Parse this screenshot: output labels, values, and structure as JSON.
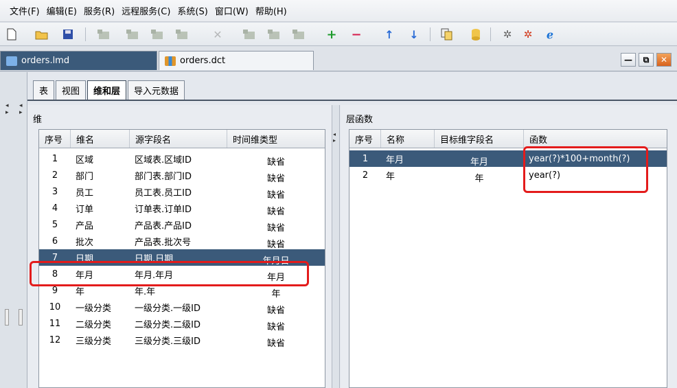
{
  "menu": [
    "文件(F)",
    "编辑(E)",
    "服务(R)",
    "远程服务(C)",
    "系统(S)",
    "窗口(W)",
    "帮助(H)"
  ],
  "toolbar_icons": [
    "new-file-icon",
    "open-folder-icon",
    "save-icon",
    "table-add-icon",
    "table-edit-icon",
    "table-delete-icon",
    "table-icon",
    "delete-x-icon",
    "field-add-icon",
    "field-edit-icon",
    "field-delete-icon",
    "plus-icon",
    "minus-icon",
    "arrow-up-icon",
    "arrow-down-icon",
    "copy-icon",
    "database-icon",
    "fish-icon",
    "fish-red-icon",
    "browser-icon"
  ],
  "doc_tabs": {
    "active": "orders.lmd",
    "inactive": "orders.dct"
  },
  "inner_tabs": [
    "表",
    "视图",
    "维和层",
    "导入元数据"
  ],
  "left_panel": {
    "title": "维",
    "headers": [
      "序号",
      "维名",
      "源字段名",
      "时间维类型"
    ],
    "rows": [
      [
        "1",
        "区域",
        "区域表.区域ID",
        "缺省"
      ],
      [
        "2",
        "部门",
        "部门表.部门ID",
        "缺省"
      ],
      [
        "3",
        "员工",
        "员工表.员工ID",
        "缺省"
      ],
      [
        "4",
        "订单",
        "订单表.订单ID",
        "缺省"
      ],
      [
        "5",
        "产品",
        "产品表.产品ID",
        "缺省"
      ],
      [
        "6",
        "批次",
        "产品表.批次号",
        "缺省"
      ],
      [
        "7",
        "日期",
        "日期.日期",
        "年月日"
      ],
      [
        "8",
        "年月",
        "年月.年月",
        "年月"
      ],
      [
        "9",
        "年",
        "年.年",
        "年"
      ],
      [
        "10",
        "一级分类",
        "一级分类.一级ID",
        "缺省"
      ],
      [
        "11",
        "二级分类",
        "二级分类.二级ID",
        "缺省"
      ],
      [
        "12",
        "三级分类",
        "三级分类.三级ID",
        "缺省"
      ]
    ]
  },
  "right_panel": {
    "title": "层函数",
    "headers": [
      "序号",
      "名称",
      "目标维字段名",
      "函数"
    ],
    "rows": [
      [
        "1",
        "年月",
        "年月",
        "year(?)*100+month(?)"
      ],
      [
        "2",
        "年",
        "年",
        "year(?)"
      ]
    ]
  },
  "colors": {
    "selection": "#3b5a7a",
    "highlight_box": "#e31b1b"
  }
}
